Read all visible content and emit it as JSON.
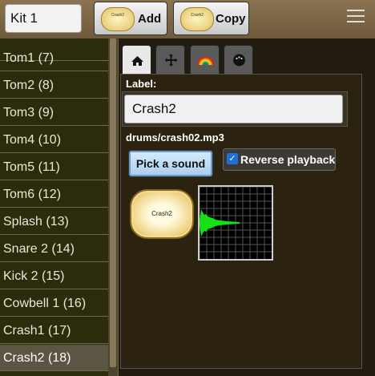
{
  "topbar": {
    "kit_name": "Kit 1",
    "add_label": "Add",
    "copy_label": "Copy",
    "pad_mini_label": "Crash2"
  },
  "sidebar": {
    "items": [
      {
        "label": "Tom1 (7)"
      },
      {
        "label": "Tom2 (8)"
      },
      {
        "label": "Tom3 (9)"
      },
      {
        "label": "Tom4 (10)"
      },
      {
        "label": "Tom5 (11)"
      },
      {
        "label": "Tom6 (12)"
      },
      {
        "label": "Splash (13)"
      },
      {
        "label": "Snare 2 (14)"
      },
      {
        "label": "Kick 2 (15)"
      },
      {
        "label": "Cowbell 1 (16)"
      },
      {
        "label": "Crash1 (17)"
      },
      {
        "label": "Crash2 (18)"
      }
    ],
    "selected": "Crash2 (18)"
  },
  "tabs": [
    {
      "icon": "home-icon"
    },
    {
      "icon": "move-icon"
    },
    {
      "icon": "rainbow-icon"
    },
    {
      "icon": "drum-icon"
    }
  ],
  "editor": {
    "label_heading": "Label:",
    "label_value": "Crash2",
    "file_path": "drums/crash02.mp3",
    "pick_button": "Pick a sound",
    "reverse_label": "Reverse playback",
    "reverse_checked": true,
    "pad_label": "Crash2"
  },
  "colors": {
    "accent": "#1f6fd6",
    "waveform": "#16e016"
  }
}
